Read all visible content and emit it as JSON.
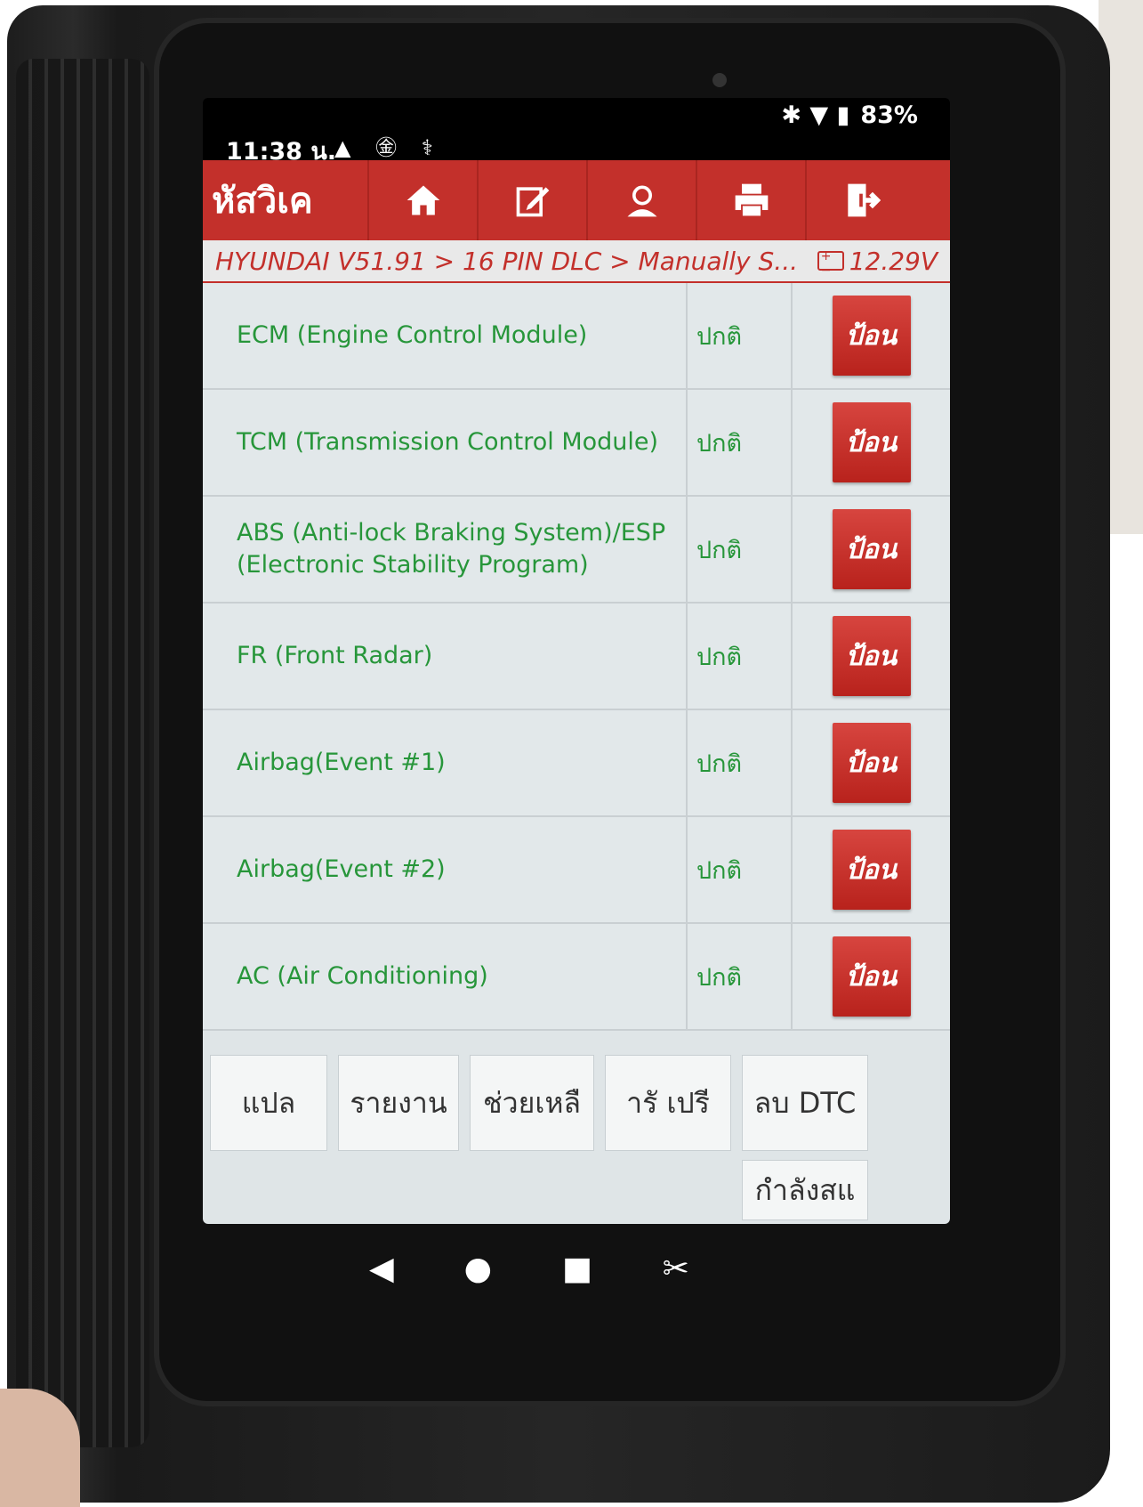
{
  "status": {
    "time": "11:38 น.",
    "left_icons": "▲ ㊎ ⚕",
    "right_icons": "✱ ▼ ▮",
    "battery": "83%"
  },
  "appbar": {
    "title": "หัสวิเค",
    "buttons": [
      "home-icon",
      "edit-icon",
      "support-icon",
      "print-icon",
      "exit-icon"
    ]
  },
  "path": {
    "breadcrumb": "HYUNDAI V51.91 > 16 PIN DLC > Manually S...",
    "voltage": "12.29V"
  },
  "modules": [
    {
      "name": "ECM (Engine Control Module)",
      "status": "ปกติ",
      "action": "ป้อน"
    },
    {
      "name": "TCM (Transmission Control Module)",
      "status": "ปกติ",
      "action": "ป้อน"
    },
    {
      "name": "ABS (Anti-lock Braking System)/ESP (Electronic Stability Program)",
      "status": "ปกติ",
      "action": "ป้อน"
    },
    {
      "name": "FR (Front Radar)",
      "status": "ปกติ",
      "action": "ป้อน"
    },
    {
      "name": "Airbag(Event #1)",
      "status": "ปกติ",
      "action": "ป้อน"
    },
    {
      "name": "Airbag(Event #2)",
      "status": "ปกติ",
      "action": "ป้อน"
    },
    {
      "name": "AC (Air Conditioning)",
      "status": "ปกติ",
      "action": "ป้อน"
    }
  ],
  "toolbar": {
    "translate": "แปล",
    "report": "รายงาน",
    "help": "ช่วยเหลื",
    "preview": "ารั  เปรี",
    "clear_dtc": "ลบ DTC",
    "scanning": "กำลังสแ"
  },
  "navbar": {
    "back": "◀",
    "home": "●",
    "recent": "■",
    "screenshot": "✂"
  }
}
